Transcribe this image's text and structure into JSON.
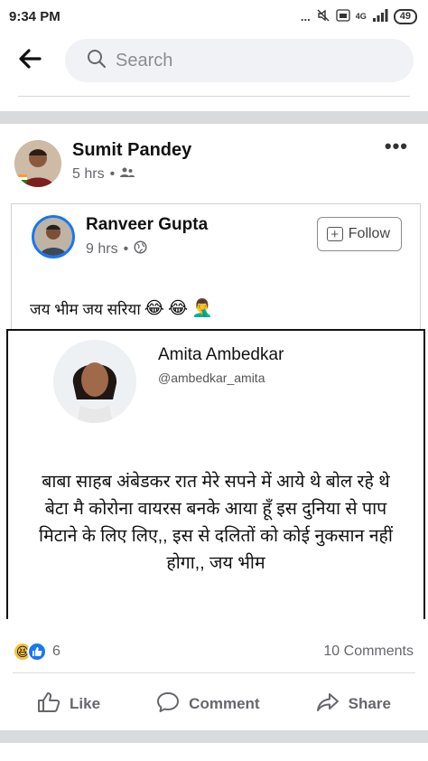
{
  "status_bar": {
    "time": "9:34 PM",
    "indicators": "... ",
    "network": "4G",
    "battery": "49"
  },
  "search": {
    "placeholder": "Search"
  },
  "post": {
    "author": "Sumit Pandey",
    "time": "5 hrs",
    "audience_icon": "friends-icon"
  },
  "shared_post": {
    "author": "Ranveer Gupta",
    "time": "9 hrs",
    "audience_icon": "globe-icon",
    "follow_label": "Follow",
    "text": "जय भीम जय सरिया",
    "emojis": [
      "😂",
      "😂",
      "🤦‍♂️"
    ],
    "tweet": {
      "name": "Amita Ambedkar",
      "handle": "@ambedkar_amita",
      "body": "बाबा साहब अंबेडकर रात मेरे सपने में आये थे बोल रहे थे बेटा मै कोरोना वायरस बनके आया हूँ इस दुनिया से पाप मिटाने के लिए लिए,, इस से दलितों को कोई नुकसान नहीं होगा,, जय भीम"
    }
  },
  "reactions": {
    "count": "6",
    "comments": "10 Comments"
  },
  "actions": {
    "like": "Like",
    "comment": "Comment",
    "share": "Share"
  },
  "colors": {
    "accent": "#1877f2",
    "muted": "#65676b",
    "divider": "#d9dadc"
  }
}
